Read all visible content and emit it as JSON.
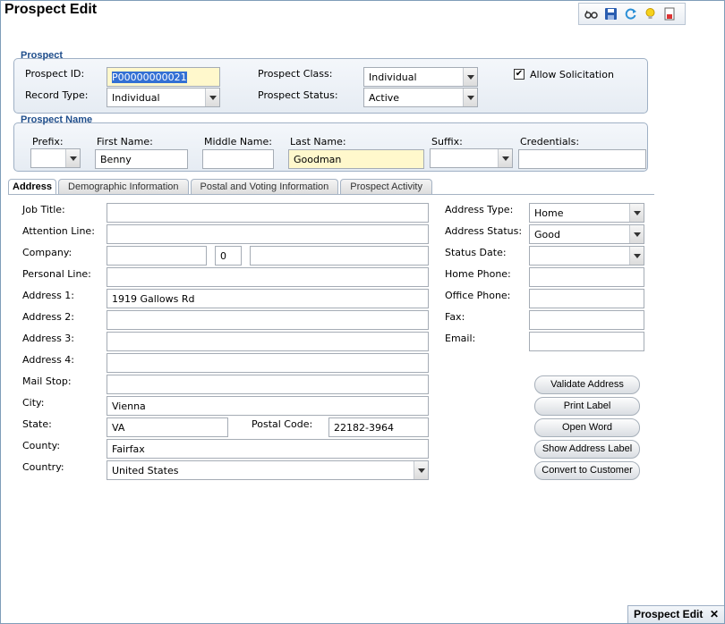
{
  "window": {
    "title": "Prospect Edit"
  },
  "toolbar": {
    "icons": [
      "glasses-icon",
      "save-icon",
      "refresh-icon",
      "lightbulb-icon",
      "report-icon"
    ]
  },
  "prospect": {
    "group_title": "Prospect",
    "id_label": "Prospect ID:",
    "id_value": "P00000000021",
    "record_type_label": "Record Type:",
    "record_type_value": "Individual",
    "class_label": "Prospect Class:",
    "class_value": "Individual",
    "status_label": "Prospect Status:",
    "status_value": "Active",
    "allow_solicitation_label": "Allow Solicitation",
    "allow_solicitation_checked": "✔"
  },
  "prospect_name": {
    "group_title": "Prospect Name",
    "prefix_label": "Prefix:",
    "prefix_value": "",
    "first_label": "First Name:",
    "first_value": "Benny",
    "middle_label": "Middle Name:",
    "middle_value": "",
    "last_label": "Last Name:",
    "last_value": "Goodman",
    "suffix_label": "Suffix:",
    "suffix_value": "",
    "credentials_label": "Credentials:",
    "credentials_value": ""
  },
  "tabs": [
    {
      "label": "Address"
    },
    {
      "label": "Demographic Information"
    },
    {
      "label": "Postal and Voting Information"
    },
    {
      "label": "Prospect Activity"
    }
  ],
  "address": {
    "job_title_label": "Job Title:",
    "job_title_value": "",
    "attention_label": "Attention Line:",
    "attention_value": "",
    "company_label": "Company:",
    "company_value": "",
    "company_num": "0",
    "company_extra": "",
    "personal_label": "Personal Line:",
    "personal_value": "",
    "address1_label": "Address 1:",
    "address1_value": "1919 Gallows Rd",
    "address2_label": "Address 2:",
    "address2_value": "",
    "address3_label": "Address 3:",
    "address3_value": "",
    "address4_label": "Address 4:",
    "address4_value": "",
    "mailstop_label": "Mail Stop:",
    "mailstop_value": "",
    "city_label": "City:",
    "city_value": "Vienna",
    "state_label": "State:",
    "state_value": "VA",
    "postal_label": "Postal Code:",
    "postal_value": "22182-3964",
    "county_label": "County:",
    "county_value": "Fairfax",
    "country_label": "Country:",
    "country_value": "United States",
    "address_type_label": "Address Type:",
    "address_type_value": "Home",
    "address_status_label": "Address Status:",
    "address_status_value": "Good",
    "status_date_label": "Status Date:",
    "status_date_value": "",
    "home_phone_label": "Home Phone:",
    "home_phone_value": "",
    "office_phone_label": "Office Phone:",
    "office_phone_value": "",
    "fax_label": "Fax:",
    "fax_value": "",
    "email_label": "Email:",
    "email_value": ""
  },
  "buttons": {
    "validate": "Validate Address",
    "print": "Print Label",
    "open_word": "Open Word",
    "show_label": "Show Address Label",
    "convert": "Convert to Customer"
  },
  "bottom_tab": {
    "label": "Prospect Edit",
    "close": "✕"
  }
}
